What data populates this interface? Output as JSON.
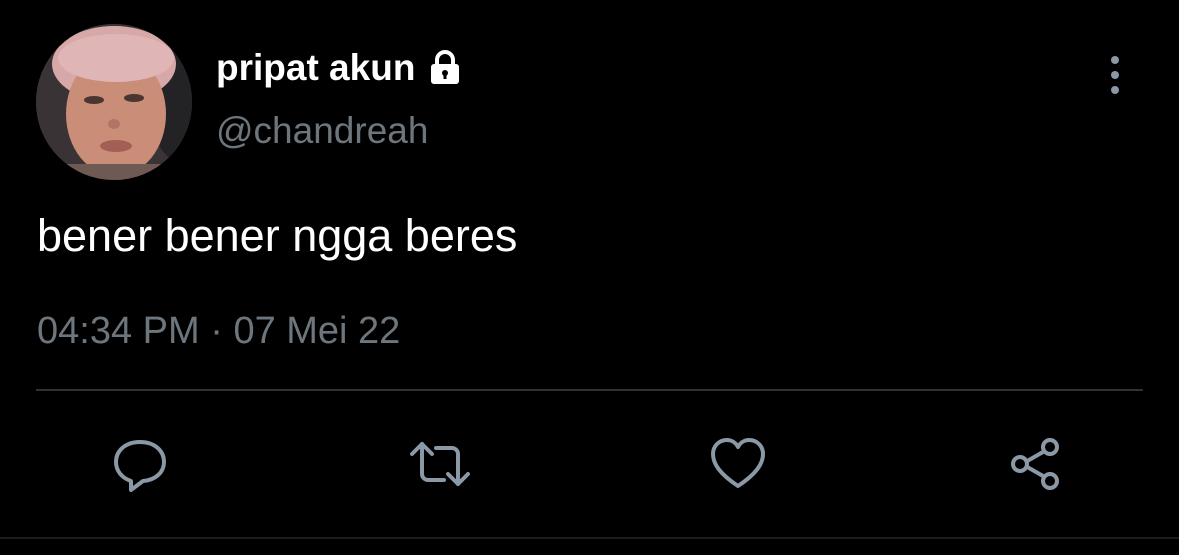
{
  "user": {
    "display_name": "pripat akun",
    "handle": "@chandreah",
    "locked_icon": "lock-icon",
    "avatar_icon": "avatar"
  },
  "tweet": {
    "text": "bener bener ngga beres",
    "time": "04:34 PM",
    "separator": "·",
    "date": "07 Mei 22"
  },
  "actions": [
    {
      "icon": "reply-icon"
    },
    {
      "icon": "retweet-icon"
    },
    {
      "icon": "like-icon"
    },
    {
      "icon": "share-icon"
    }
  ],
  "menu_icon": "more-vertical-icon",
  "colors": {
    "background": "#000000",
    "text": "#ffffff",
    "secondary_text": "#6e767d",
    "icon": "#8b98a5",
    "divider": "#2f3336"
  }
}
